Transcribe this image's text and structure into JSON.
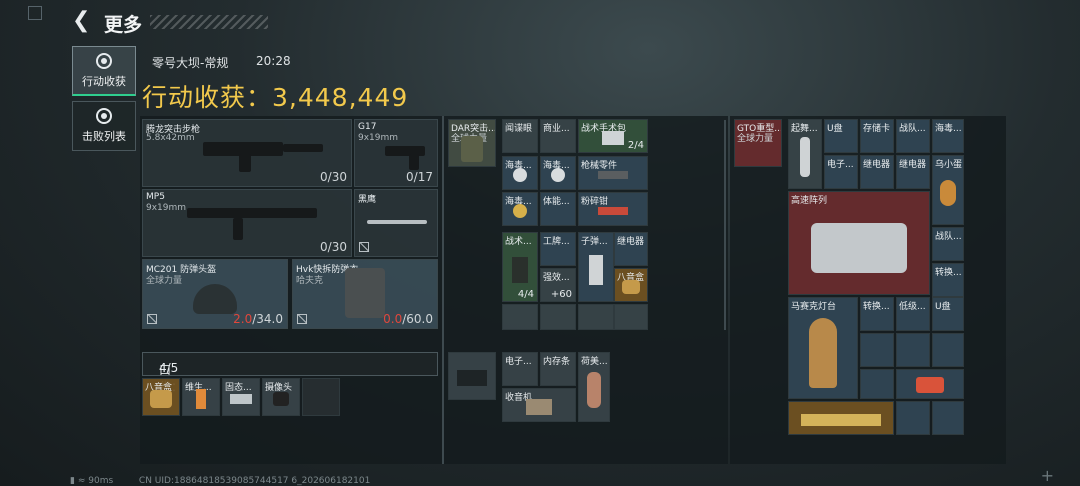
{
  "header": {
    "title": "更多"
  },
  "tabs": [
    {
      "label": "行动收获"
    },
    {
      "label": "击败列表"
    }
  ],
  "match": {
    "map": "零号大坝-常规",
    "time": "20:28"
  },
  "haul": {
    "label": "行动收获：",
    "value": "3,448,449"
  },
  "loadout": {
    "primary": {
      "name": "腾龙突击步枪",
      "ammo_type": "5.8x42mm",
      "ammo": "0/30"
    },
    "pistol": {
      "name": "G17",
      "ammo_type": "9x19mm",
      "ammo": "0/17"
    },
    "secondary": {
      "name": "MP5",
      "ammo_type": "9x19mm",
      "ammo": "0/30"
    },
    "melee": {
      "name": "黑鹰"
    },
    "helmet": {
      "name": "MC201 防弹头盔",
      "tag": "全球力量",
      "dur_cur": "2.0",
      "dur_max": "/34.0"
    },
    "armor": {
      "name": "Hvk快拆防弹衣",
      "tag": "哈夫克",
      "dur_cur": "0.0",
      "dur_max": "/60.0"
    }
  },
  "pocket": {
    "label": "口袋：",
    "count": "4/5",
    "items": [
      {
        "name": "八音盒"
      },
      {
        "name": "维生..."
      },
      {
        "name": "固态..."
      },
      {
        "name": "摄像头"
      }
    ]
  },
  "chest_rig": {
    "name": "DAR突击...",
    "tag": "全球力量",
    "items": [
      {
        "name": "闻谍眼"
      },
      {
        "name": "商业..."
      },
      {
        "name": "战术手术包",
        "count": "2/4"
      },
      {
        "name": "海毒..."
      },
      {
        "name": "海毒..."
      },
      {
        "name": "枪械零件"
      },
      {
        "name": "海毒..."
      },
      {
        "name": "体能..."
      },
      {
        "name": "粉碎钳"
      },
      {
        "name": "战术...",
        "count": "4/4"
      },
      {
        "name": "工牌..."
      },
      {
        "name": "子弹..."
      },
      {
        "name": "继电器"
      },
      {
        "name": "强效...",
        "count": "60"
      },
      {
        "name": "八音盒"
      }
    ]
  },
  "pouch": {
    "items": [
      {
        "name": "电子..."
      },
      {
        "name": "内存条"
      },
      {
        "name": "荷美..."
      },
      {
        "name": "收音机"
      }
    ]
  },
  "backpack": {
    "name": "GTO重型...",
    "tag": "全球力量",
    "items": [
      {
        "name": "起舞..."
      },
      {
        "name": "U盘"
      },
      {
        "name": "存储卡"
      },
      {
        "name": "战队..."
      },
      {
        "name": "海毒..."
      },
      {
        "name": "电子..."
      },
      {
        "name": "继电器"
      },
      {
        "name": "继电器"
      },
      {
        "name": "继电器"
      },
      {
        "name": "乌小蛋"
      },
      {
        "name": "高速阵列"
      },
      {
        "name": "战队..."
      },
      {
        "name": "转换..."
      },
      {
        "name": "马赛克灯台"
      },
      {
        "name": "转换..."
      },
      {
        "name": "低级..."
      },
      {
        "name": "U盘"
      }
    ]
  },
  "footer": {
    "ping": "90ms",
    "uid": "CN UID:18864818539085744517 6_202606182101"
  },
  "colors": {
    "gold": "#f2c94c",
    "accent": "#2fcf8f",
    "red": "#e0473c"
  }
}
